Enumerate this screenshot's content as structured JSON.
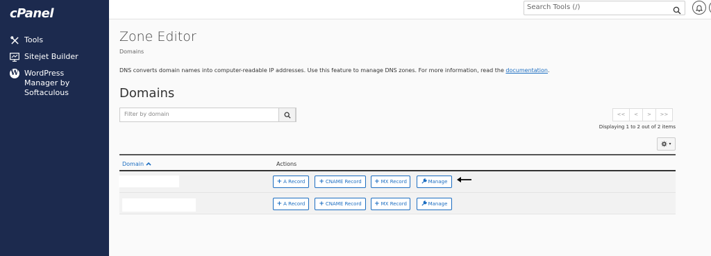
{
  "sidebar": {
    "logo": "cPanel",
    "items": [
      {
        "label": "Tools",
        "icon": "tools-icon"
      },
      {
        "label": "Sitejet Builder",
        "icon": "sitejet-icon"
      },
      {
        "label": "WordPress Manager by Softaculous",
        "icon": "wordpress-icon"
      }
    ]
  },
  "topbar": {
    "search_placeholder": "Search Tools (/)",
    "icons": [
      "search-icon",
      "bell-icon",
      "user-icon"
    ]
  },
  "page": {
    "title": "Zone Editor",
    "breadcrumb": "Domains",
    "description": "DNS converts domain names into computer-readable IP addresses. Use this feature to manage DNS zones. For more information, read the ",
    "description_link": "documentation",
    "description_end": "."
  },
  "domains": {
    "title": "Domains",
    "filter_placeholder": "Filter by domain",
    "pager": {
      "first": "<<",
      "prev": "<",
      "next": ">",
      "last": ">>"
    },
    "displaying": "Displaying 1 to 2 out of 2 items",
    "columns": {
      "domain": "Domain",
      "actions": "Actions"
    },
    "actions": {
      "a_record": "A Record",
      "cname_record": "CNAME Record",
      "mx_record": "MX Record",
      "manage": "Manage"
    }
  },
  "colors": {
    "sidebar_bg": "#1c2a4e",
    "link": "#1b6dc1",
    "row_bg": "#f2f2f2"
  }
}
